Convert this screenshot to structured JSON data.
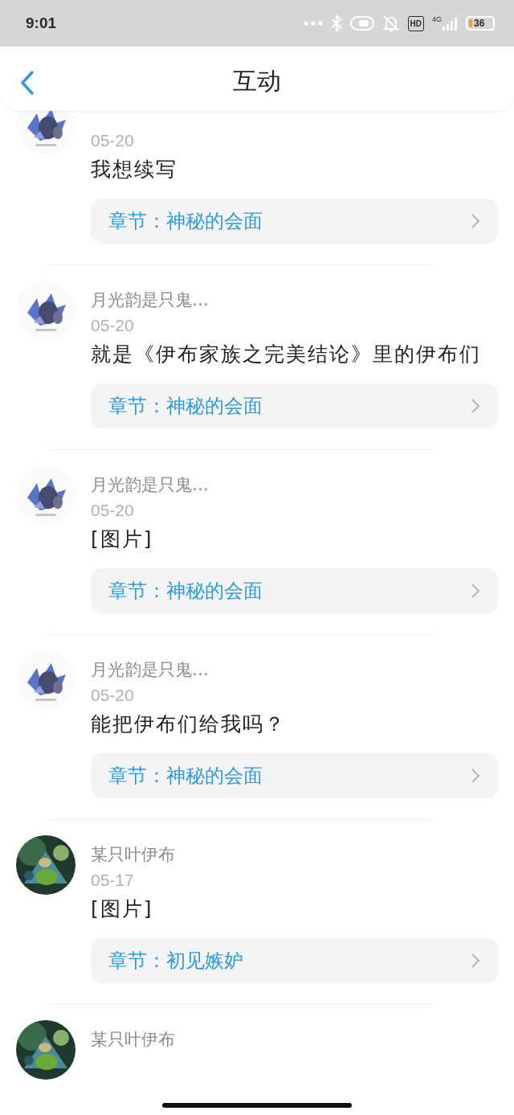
{
  "status_bar": {
    "time": "9:01",
    "hd": "HD",
    "network": "4G",
    "battery": "36"
  },
  "header": {
    "title": "互动"
  },
  "comments": [
    {
      "date": "05-20",
      "text": "我想续写",
      "chapter": "章节：神秘的会面"
    },
    {
      "name": "月光韵是只鬼…",
      "date": "05-20",
      "text": "就是《伊布家族之完美结论》里的伊布们",
      "chapter": "章节：神秘的会面"
    },
    {
      "name": "月光韵是只鬼…",
      "date": "05-20",
      "text": "[图片]",
      "chapter": "章节：神秘的会面"
    },
    {
      "name": "月光韵是只鬼…",
      "date": "05-20",
      "text": "能把伊布们给我吗？",
      "chapter": "章节：神秘的会面"
    },
    {
      "name": "某只叶伊布",
      "date": "05-17",
      "text": "[图片]",
      "chapter": "章节：初见嫉妒"
    },
    {
      "name": "某只叶伊布"
    }
  ]
}
